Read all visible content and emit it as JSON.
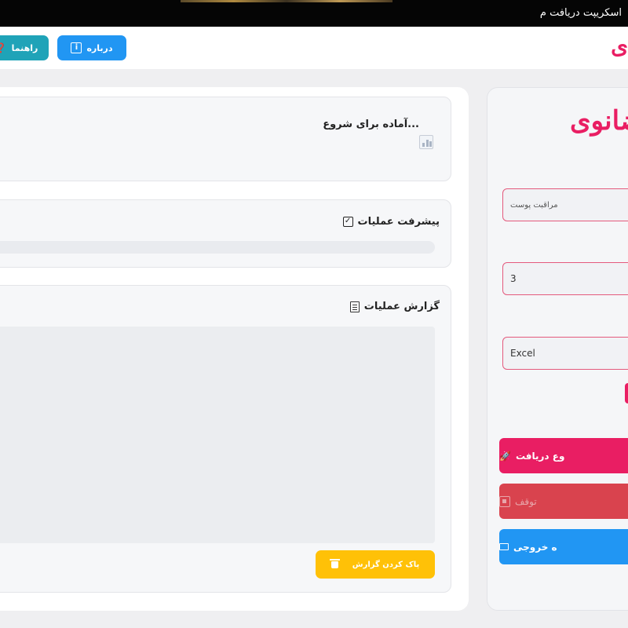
{
  "window": {
    "title": "اسکریپت دریافت م"
  },
  "header": {
    "about_label": "درباره",
    "help_label": "راهنما",
    "brand": "ی"
  },
  "status": {
    "text": "...آماده برای شروع"
  },
  "progress": {
    "title": "پیشرفت عملیات",
    "value": 0
  },
  "log": {
    "title": "گزارش عملیات",
    "content": "",
    "clear_label": "پاک کردن گزارش"
  },
  "sidebar": {
    "logo": "ضانوی",
    "category_value": "مراقبت پوست",
    "count_value": "3",
    "format_value": "Excel",
    "start_label": "وع دریافت",
    "stop_label": "توقف",
    "folder_label": "ه خروجی"
  },
  "colors": {
    "brand": "#e91e63",
    "about": "#2196f3",
    "help": "#1fa3b8",
    "clear": "#ffc107",
    "stop": "#d9434e"
  },
  "icons": {
    "about": "info-icon",
    "help": "question-icon",
    "status": "chart-icon",
    "progress": "check-icon",
    "log": "memo-icon",
    "clear": "trash-icon",
    "start": "rocket-icon",
    "stop": "stop-icon",
    "folder": "folder-icon"
  }
}
